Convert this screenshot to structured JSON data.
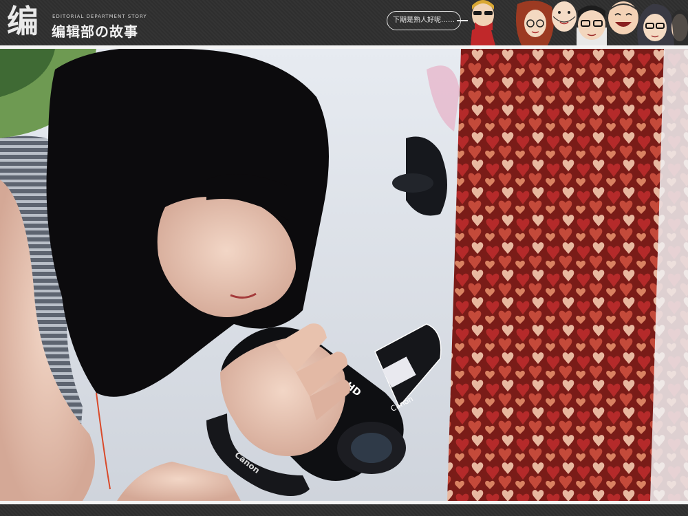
{
  "header": {
    "logo_glyph": "编",
    "logo_subtitle": "EDITORIAL DEPARTMENT STORY",
    "logo_title": "编辑部の故事",
    "speech_bubble": "下期是熟人好呢……"
  },
  "photo": {
    "camera_brand": "Canon",
    "camera_badge": "HD",
    "strap_text": "Canon"
  },
  "colors": {
    "header_bg": "#2e2e2e",
    "rule": "#f4f4f4",
    "heart_red": "#b52a2a",
    "heart_light": "#e8b8a0"
  },
  "icons": {
    "avatar_1": "sunglasses-red-scarf-cartoon-icon",
    "avatar_2": "red-haired-glasses-cartoon-icon",
    "avatar_3": "bald-man-cartoon-icon",
    "avatar_4": "black-hair-glasses-cartoon-icon",
    "avatar_5": "round-face-laughing-cartoon-icon",
    "avatar_6": "glasses-girl-cartoon-icon"
  }
}
